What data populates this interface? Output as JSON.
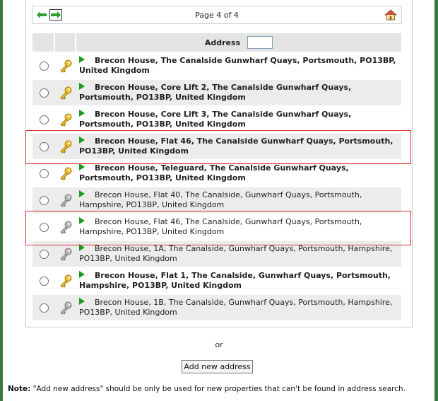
{
  "pager": {
    "page_text": "Page 4 of 4",
    "prev_icon": "arrow-left-icon",
    "next_icon": "arrow-right-icon",
    "home_icon": "home-icon"
  },
  "table": {
    "header": "Address",
    "filter_value": "",
    "rows": [
      {
        "address": "Brecon House, The Canalside Gunwharf Quays, Portsmouth, PO13BP, United Kingdom",
        "bold": true,
        "key": "gold",
        "shaded": false
      },
      {
        "address": "Brecon House, Core Lift 2, The Canalside Gunwharf Quays, Portsmouth, PO13BP, United Kingdom",
        "bold": true,
        "key": "gold",
        "shaded": true
      },
      {
        "address": "Brecon House, Core Lift 3, The Canalside Gunwharf Quays, Portsmouth, PO13BP, United Kingdom",
        "bold": true,
        "key": "gold",
        "shaded": false
      },
      {
        "address": "Brecon House, Flat 46, The Canalside Gunwharf Quays, Portsmouth, PO13BP, United Kingdom",
        "bold": true,
        "key": "gold",
        "shaded": true
      },
      {
        "address": "Brecon House, Teleguard, The Canalside Gunwharf Quays, Portsmouth, PO13BP, United Kingdom",
        "bold": true,
        "key": "gold",
        "shaded": false
      },
      {
        "address": "Brecon House, Flat 40, The Canalside, Gunwharf Quays, Portsmouth, Hampshire, PO13BP, United Kingdom",
        "bold": false,
        "key": "grey",
        "shaded": true
      },
      {
        "address": "Brecon House, Flat 46, The Canalside, Gunwharf Quays, Portsmouth, Hampshire, PO13BP, United Kingdom",
        "bold": false,
        "key": "grey",
        "shaded": false
      },
      {
        "address": "Brecon House, 1A, The Canalside, Gunwharf Quays, Portsmouth, Hampshire, PO13BP, United Kingdom",
        "bold": false,
        "key": "grey",
        "shaded": true
      },
      {
        "address": "Brecon House, Flat 1, The Canalside, Gunwharf Quays, Portsmouth, Hampshire, PO13BP, United Kingdom",
        "bold": true,
        "key": "gold",
        "shaded": false
      },
      {
        "address": "Brecon House, 1B, The Canalside, Gunwharf Quays, Portsmouth, Hampshire, PO13BP, United Kingdom",
        "bold": false,
        "key": "grey",
        "shaded": true
      }
    ]
  },
  "or_text": "or",
  "add_button_label": "Add new address",
  "note": {
    "label": "Note:",
    "text": " \"Add new address\" should be only be used for new properties that can't be found in address search."
  },
  "colors": {
    "frame": "#3d7a3d",
    "row_shade": "#ececec",
    "highlight": "#dd3333",
    "play": "#1c9a1c"
  }
}
